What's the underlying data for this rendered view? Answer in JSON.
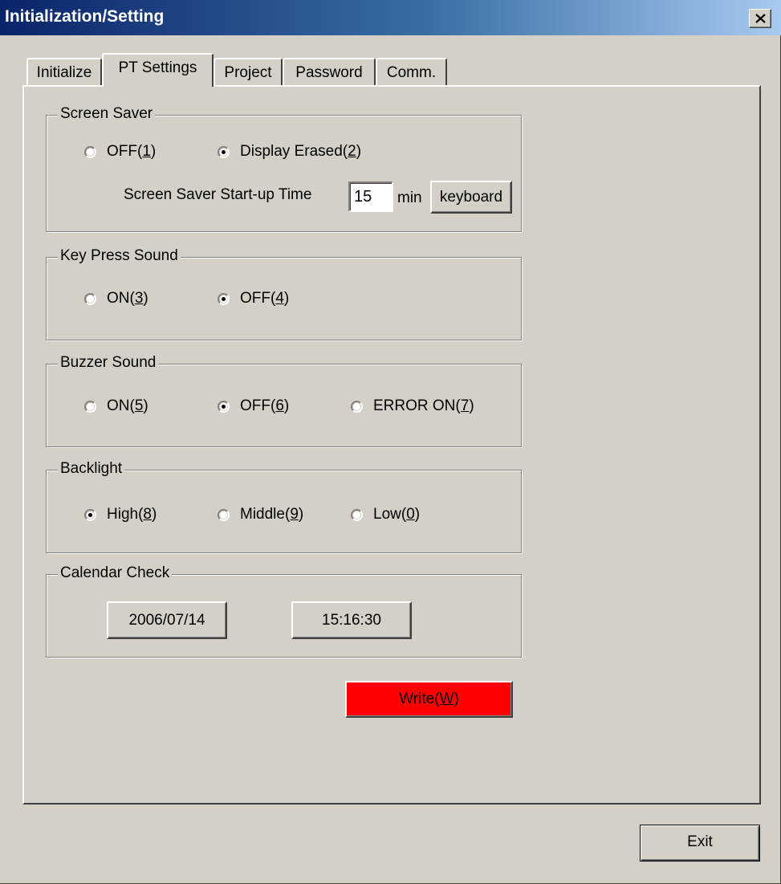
{
  "window": {
    "title": "Initialization/Setting"
  },
  "tabs": [
    {
      "label": "Initialize"
    },
    {
      "label": "PT Settings",
      "active": true
    },
    {
      "label": "Project"
    },
    {
      "label": "Password"
    },
    {
      "label": "Comm."
    }
  ],
  "screen_saver": {
    "group_label": "Screen Saver",
    "off": {
      "text": "OFF(",
      "key": "1",
      "close": ")",
      "selected": false
    },
    "display_erased": {
      "text": "Display Erased(",
      "key": "2",
      "close": ")",
      "selected": true
    },
    "startup_label": "Screen Saver Start-up Time",
    "startup_value": "15",
    "unit": "min",
    "keyboard_label": "keyboard"
  },
  "key_press_sound": {
    "group_label": "Key Press Sound",
    "on": {
      "text": "ON(",
      "key": "3",
      "close": ")",
      "selected": false
    },
    "off": {
      "text": "OFF(",
      "key": "4",
      "close": ")",
      "selected": true
    }
  },
  "buzzer_sound": {
    "group_label": "Buzzer Sound",
    "on": {
      "text": "ON(",
      "key": "5",
      "close": ")",
      "selected": false
    },
    "off": {
      "text": "OFF(",
      "key": "6",
      "close": ")",
      "selected": true
    },
    "error_on": {
      "text": "ERROR ON(",
      "key": "7",
      "close": ")",
      "selected": false
    }
  },
  "backlight": {
    "group_label": "Backlight",
    "high": {
      "text": "High(",
      "key": "8",
      "close": ")",
      "selected": true
    },
    "middle": {
      "text": "Middle(",
      "key": "9",
      "close": ")",
      "selected": false
    },
    "low": {
      "text": "Low(",
      "key": "0",
      "close": ")",
      "selected": false
    }
  },
  "calendar_check": {
    "group_label": "Calendar Check",
    "date": "2006/07/14",
    "time": "15:16:30"
  },
  "write_button": {
    "text": "Write(",
    "key": "W",
    "close": ")",
    "color": "#ff0000"
  },
  "exit_button": {
    "label": "Exit"
  }
}
